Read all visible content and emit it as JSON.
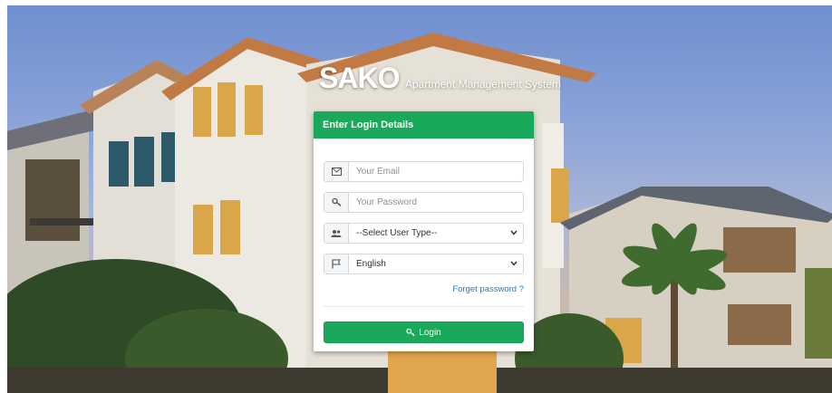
{
  "brand": {
    "name": "SAKO",
    "tagline": "Apartment Management System"
  },
  "login_card": {
    "header": "Enter Login Details",
    "email": {
      "placeholder": "Your Email",
      "icon": "envelope-icon"
    },
    "password": {
      "placeholder": "Your Password",
      "icon": "key-icon"
    },
    "user_type": {
      "selected": "--Select User Type--",
      "icon": "users-icon"
    },
    "language": {
      "selected": "English",
      "icon": "flag-icon"
    },
    "forgot_password": "Forget password ?",
    "login_button": "Login"
  },
  "colors": {
    "accent": "#1aa85a",
    "link": "#1f78c8"
  }
}
